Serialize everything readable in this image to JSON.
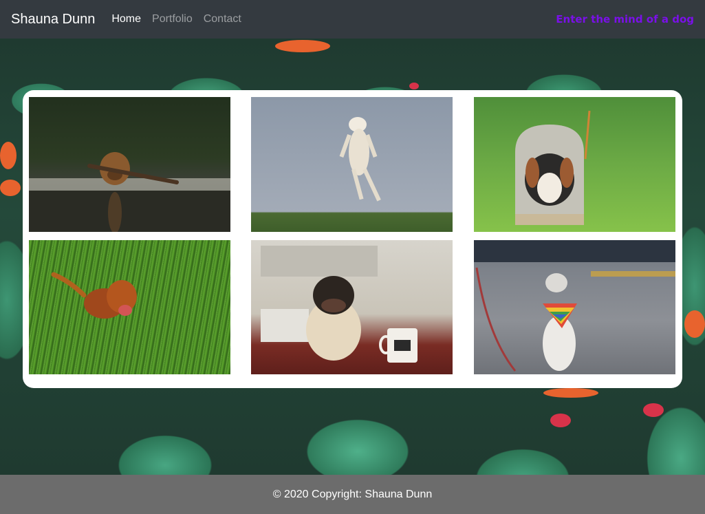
{
  "navbar": {
    "brand": "Shauna Dunn",
    "links": [
      {
        "label": "Home",
        "active": true
      },
      {
        "label": "Portfolio",
        "active": false
      },
      {
        "label": "Contact",
        "active": false
      }
    ],
    "tagline": "Enter the mind of a dog",
    "tagline_color": "#7a10e8"
  },
  "gallery": {
    "photos": [
      {
        "subject": "dog swimming with stick"
      },
      {
        "subject": "dog jumping in air"
      },
      {
        "subject": "dog in mailbox"
      },
      {
        "subject": "dog in tall grass"
      },
      {
        "subject": "pug at table with mug"
      },
      {
        "subject": "dog with rainbow bandana"
      }
    ]
  },
  "footer": {
    "copyright": "© 2020 Copyright: Shauna Dunn"
  }
}
